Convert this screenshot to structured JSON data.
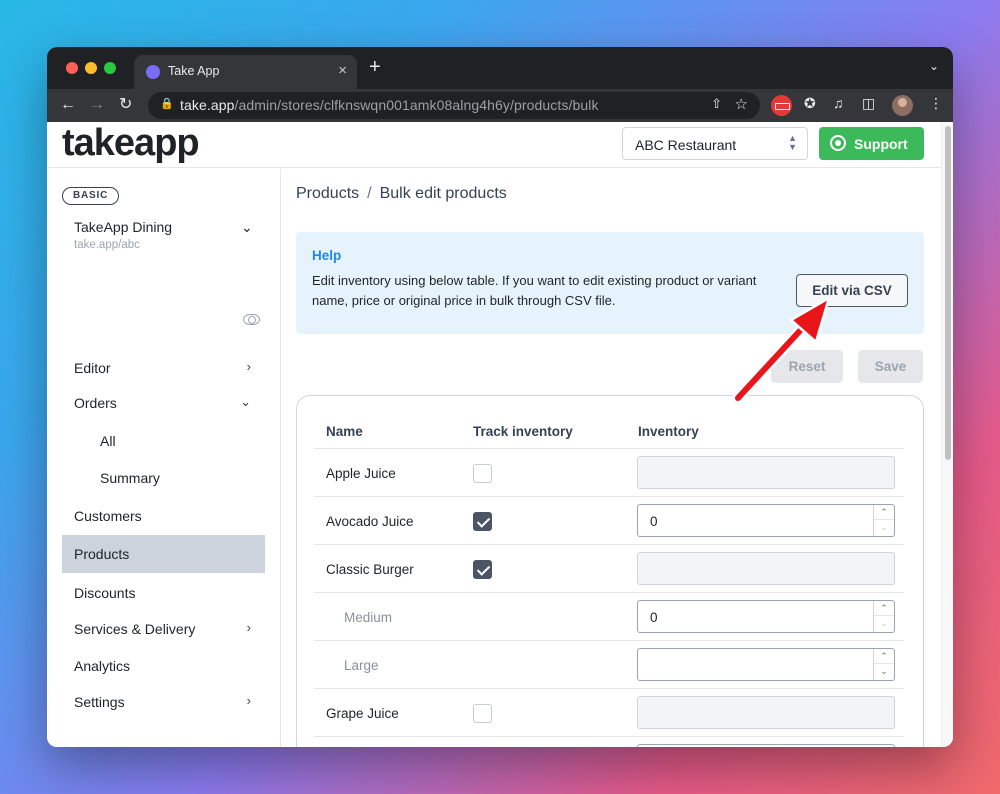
{
  "browser": {
    "tab_title": "Take App",
    "new_tab": "+",
    "close_tab": "×",
    "url_domain": "take.app",
    "url_path": "/admin/stores/clfknswqn001amk08alng4h6y/products/bulk"
  },
  "header": {
    "logo": "takeapp",
    "store_select": "ABC Restaurant",
    "support_label": "Support"
  },
  "sidebar": {
    "plan_badge": "BASIC",
    "store_name": "TakeApp Dining",
    "store_url": "take.app/abc",
    "items": [
      {
        "label": "Editor"
      },
      {
        "label": "Orders"
      },
      {
        "label": "All"
      },
      {
        "label": "Summary"
      },
      {
        "label": "Customers"
      },
      {
        "label": "Products"
      },
      {
        "label": "Discounts"
      },
      {
        "label": "Services & Delivery"
      },
      {
        "label": "Analytics"
      },
      {
        "label": "Settings"
      }
    ]
  },
  "breadcrumb": {
    "root": "Products",
    "separator": "/",
    "current": "Bulk edit products"
  },
  "help": {
    "title": "Help",
    "text": "Edit inventory using below table. If you want to edit existing product or variant name, price or original price in bulk through CSV file.",
    "csv_button": "Edit via CSV"
  },
  "actions": {
    "reset": "Reset",
    "save": "Save"
  },
  "table": {
    "headers": [
      "Name",
      "Track inventory",
      "Inventory"
    ],
    "rows": [
      {
        "name": "Apple Juice",
        "track": false,
        "inventory": ""
      },
      {
        "name": "Avocado Juice",
        "track": true,
        "inventory": "0"
      },
      {
        "name": "Classic Burger",
        "track": true,
        "inventory": ""
      },
      {
        "name": "Medium",
        "track": null,
        "inventory": "0"
      },
      {
        "name": "Large",
        "track": null,
        "inventory": ""
      },
      {
        "name": "Grape Juice",
        "track": false,
        "inventory": ""
      }
    ]
  },
  "colors": {
    "support_green": "#3cb95a",
    "help_bg": "#e7f3fc",
    "help_title": "#1e88e5",
    "active_nav": "#cdd3dc",
    "annotation_arrow": "#e8161b"
  }
}
